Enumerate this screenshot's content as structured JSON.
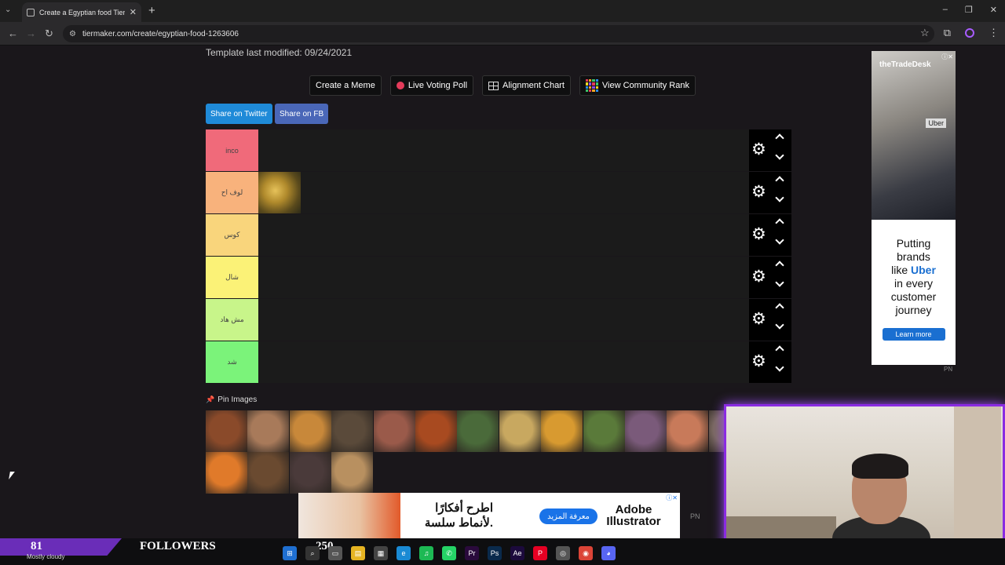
{
  "browser": {
    "tab_title": "Create a Egyptian food Tier List",
    "url": "tiermaker.com/create/egyptian-food-1263606"
  },
  "page": {
    "modified": "Template last modified: 09/24/2021",
    "buttons": {
      "meme": "Create a Meme",
      "poll": "Live Voting Poll",
      "alignment": "Alignment Chart",
      "community": "View Community Rank"
    },
    "share": {
      "twitter": "Share on Twitter",
      "fb": "Share on FB"
    },
    "tiers": [
      {
        "label": "inco",
        "color": "#f06a7a"
      },
      {
        "label": "لوف اح",
        "color": "#f8b27c"
      },
      {
        "label": "كوس",
        "color": "#f9d57c"
      },
      {
        "label": "شال",
        "color": "#fbf277"
      },
      {
        "label": "مش هاد",
        "color": "#c8f58a"
      },
      {
        "label": "شد",
        "color": "#7bf37a"
      }
    ],
    "pin_label": "Pin Images"
  },
  "ad_side": {
    "brand": "theTradeDesk",
    "tag": "Uber",
    "line1": "Putting",
    "line2": "brands",
    "line3_pre": "like",
    "line3_brand": "Uber",
    "line4": "in every",
    "line5": "customer",
    "line6": "journey",
    "cta": "Learn more",
    "mark": "PN"
  },
  "ad_bottom": {
    "arabic_line1": "اطرح أفكارًا",
    "arabic_line2": "لأنماط سلسة.",
    "cta": "معرفة المزيد",
    "logo_line1": "Adobe",
    "logo_line2": "Illustrator",
    "mark": "PN"
  },
  "stream": {
    "count_left": "81",
    "followers": "FOLLOWERS",
    "count_right": "250",
    "weather": "Mostly cloudy"
  },
  "colors": {
    "mosaic": [
      "#e33b5a",
      "#f6a623",
      "#3cc46a",
      "#2a8cf0",
      "#f6d623",
      "#8a4cf0",
      "#e33b5a",
      "#3cc46a",
      "#2a8cf0",
      "#f6a623",
      "#8a4cf0",
      "#f6d623",
      "#3cc46a",
      "#e33b5a",
      "#f6a623",
      "#2a8cf0"
    ],
    "pool": [
      "#8a4a2a",
      "#a87a5a",
      "#c8883a",
      "#5a4a3a",
      "#9a5a4a",
      "#a84a20",
      "#4a6a3a",
      "#c8a860",
      "#d89a30",
      "#5a7a3a",
      "#7a5a7a",
      "#c87a5a",
      "#7a6a60",
      "#e07a2a",
      "#6a4a30",
      "#4a3a3a",
      "#b89060"
    ]
  }
}
